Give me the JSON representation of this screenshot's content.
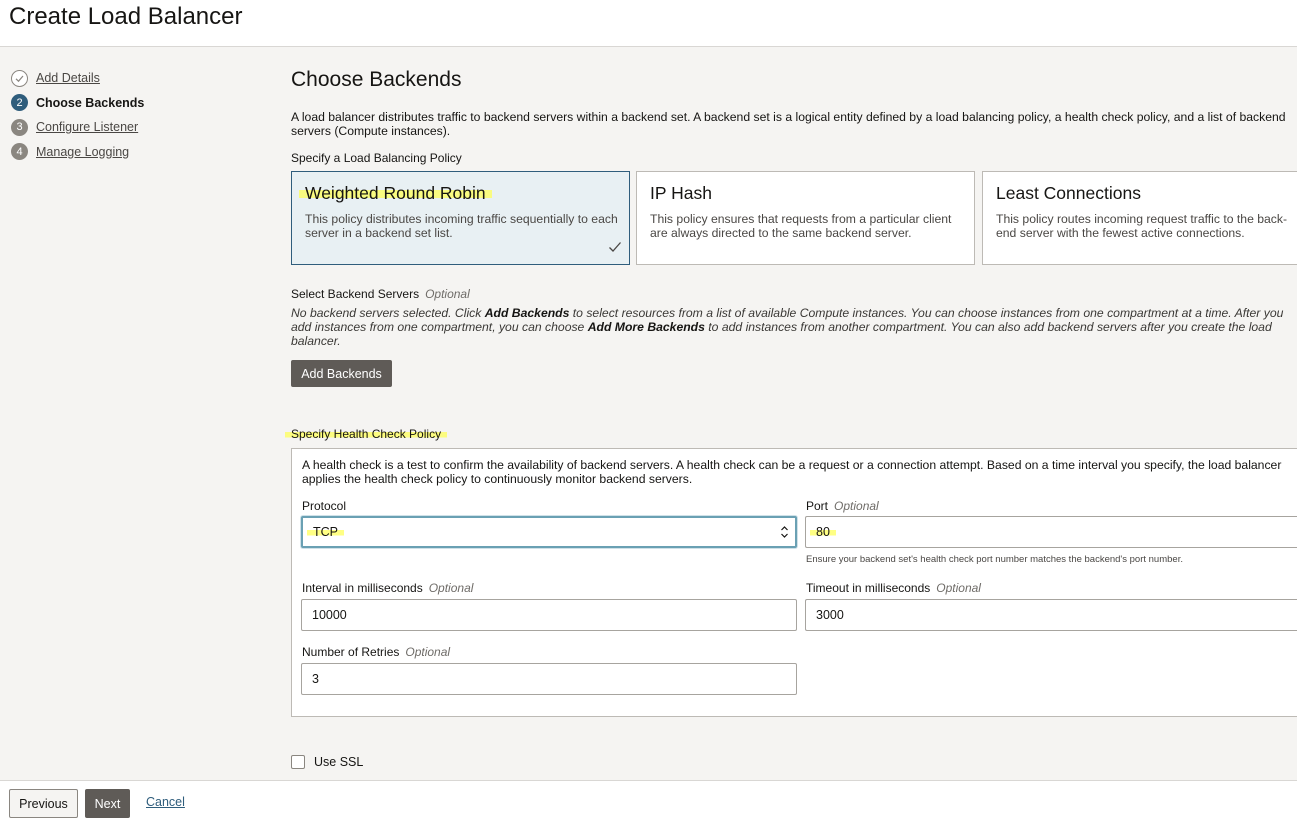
{
  "header": {
    "title": "Create Load Balancer"
  },
  "steps": [
    {
      "number": "",
      "label": "Add Details",
      "state": "done"
    },
    {
      "number": "2",
      "label": "Choose Backends",
      "state": "active"
    },
    {
      "number": "3",
      "label": "Configure Listener",
      "state": "todo"
    },
    {
      "number": "4",
      "label": "Manage Logging",
      "state": "todo"
    }
  ],
  "main": {
    "title": "Choose Backends",
    "intro_line1": "A load balancer distributes traffic to backend servers within a backend set. A backend set is a logical entity defined by a load balancing policy, a health check policy, and a list of backend",
    "intro_line2": "servers (Compute instances).",
    "policy_label": "Specify a Load Balancing Policy",
    "policies": [
      {
        "title": "Weighted Round Robin",
        "desc": "This policy distributes incoming traffic sequentially to each server in a backend set list.",
        "selected": true
      },
      {
        "title": "IP Hash",
        "desc": "This policy ensures that requests from a particular client are always directed to the same backend server.",
        "selected": false
      },
      {
        "title": "Least Connections",
        "desc": "This policy routes incoming request traffic to the back-end server with the fewest active connections.",
        "selected": false
      }
    ],
    "backend_label": "Select Backend Servers",
    "optional": "Optional",
    "backend_desc": {
      "p1": "No backend servers selected. Click ",
      "b1": "Add Backends",
      "p2": " to select resources from a list of available Compute instances. You can choose instances from one compartment at a time. After you",
      "p3": "add instances from one compartment, you can choose ",
      "b2": "Add More Backends",
      "p4": " to add instances from another compartment. You can also add backend servers after you create the load",
      "p5": "balancer."
    },
    "add_backends_button": "Add Backends",
    "health_label": "Specify Health Check Policy",
    "health": {
      "desc_line1": "A health check is a test to confirm the availability of backend servers. A health check can be a request or a connection attempt. Based on a time interval you specify, the load balancer",
      "desc_line2": "applies the health check policy to continuously monitor backend servers.",
      "protocol_label": "Protocol",
      "protocol_value": "TCP",
      "port_label": "Port",
      "port_value": "80",
      "port_hint": "Ensure your backend set's health check port number matches the backend's port number.",
      "interval_label": "Interval in milliseconds",
      "interval_value": "10000",
      "timeout_label": "Timeout in milliseconds",
      "timeout_value": "3000",
      "retries_label": "Number of Retries",
      "retries_value": "3"
    },
    "ssl_label": "Use SSL"
  },
  "footer": {
    "previous": "Previous",
    "next": "Next",
    "cancel": "Cancel"
  },
  "colors": {
    "accent": "#2f5d7c",
    "highlight": "#ffff5a",
    "dark_button": "#5f5b57"
  }
}
